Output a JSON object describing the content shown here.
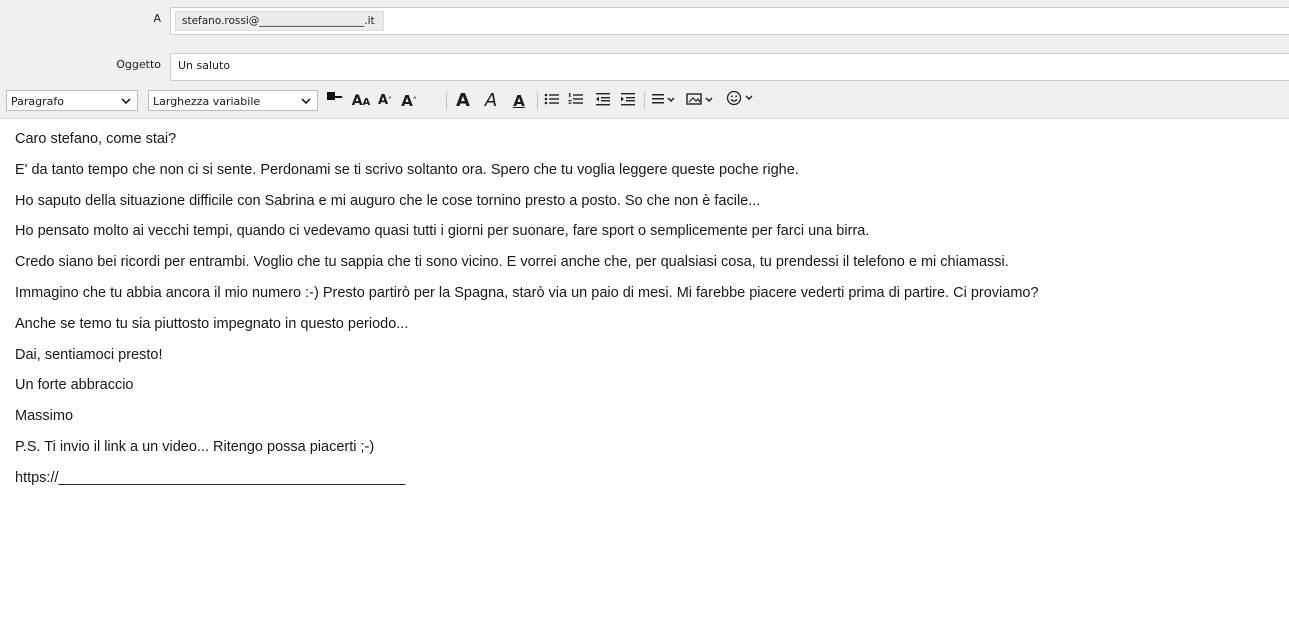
{
  "header": {
    "to_label": "A",
    "to_value": "stefano.rossi@____________________.it",
    "subject_label": "Oggetto",
    "subject_value": "Un saluto"
  },
  "toolbar": {
    "paragraph_format": "Paragrafo",
    "font_family": "Larghezza variabile",
    "icons": [
      "text-color-icon",
      "font-size-decrease-icon",
      "font-size-small-icon",
      "font-size-increase-icon",
      "bold-icon",
      "italic-icon",
      "underline-icon",
      "bullet-list-icon",
      "numbered-list-icon",
      "outdent-icon",
      "indent-icon",
      "align-icon",
      "insert-image-icon",
      "emoji-icon"
    ]
  },
  "body": {
    "lines": [
      "Caro stefano, come stai?",
      "E' da tanto tempo che non ci si sente. Perdonami se ti scrivo soltanto ora. Spero che tu voglia leggere queste poche righe.",
      "Ho saputo della situazione difficile con Sabrina e mi auguro che le cose tornino presto a posto. So che non è facile...",
      "Ho pensato molto ai vecchi tempi, quando ci vedevamo quasi tutti i giorni per suonare, fare sport o semplicemente per farci una birra.",
      "Credo siano bei ricordi per entrambi. Voglio che tu sappia che ti sono vicino. E vorrei anche che, per qualsiasi cosa, tu prendessi il telefono e mi chiamassi.",
      "Immagino che tu abbia ancora il mio numero :-) Presto partirò per la Spagna, starò via un paio di mesi. Mi farebbe piacere vederti prima di partire. Ci proviamo?",
      "Anche se temo tu sia piuttosto impegnato in questo periodo...",
      "Dai, sentiamoci presto!",
      "Un forte abbraccio",
      "Massimo",
      "P.S. Ti invio il link a un video... Ritengo possa piacerti ;-)",
      "https://___________________________________________"
    ]
  }
}
